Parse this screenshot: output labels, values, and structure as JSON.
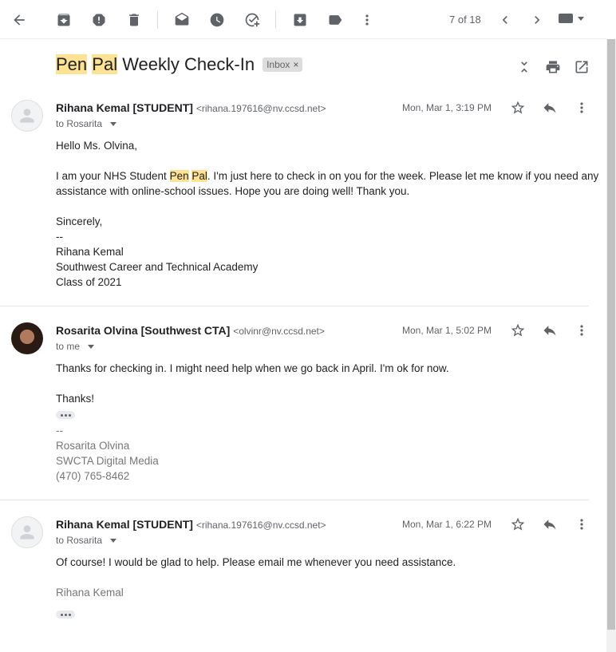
{
  "toolbar": {
    "pager": "7 of 18"
  },
  "subject": {
    "parts": [
      "Pen",
      " ",
      "Pal",
      " Weekly Check-In"
    ],
    "label": "Inbox",
    "label_close": "×"
  },
  "messages": [
    {
      "sender_name": "Rihana Kemal [STUDENT]",
      "sender_email": "<rihana.197616@nv.ccsd.net>",
      "to": "to Rosarita",
      "date": "Mon, Mar 1, 3:19 PM",
      "greeting": "Hello Ms. Olvina,",
      "body_line1_a": "I am your NHS Student ",
      "body_line1_hl1": "Pen",
      "body_line1_sp": " ",
      "body_line1_hl2": "Pal",
      "body_line1_b": ". I'm just here to check in on you for the week. Please let me know if you need any",
      "body_line2": "assistance with online-school issues. Hope you are doing well! Thank you.",
      "sign_off": "Sincerely,",
      "sig_dash": "--",
      "sig_name": "Rihana Kemal",
      "sig_school": "Southwest Career and Technical Academy",
      "sig_class": "Class of 2021"
    },
    {
      "sender_name": "Rosarita Olvina [Southwest CTA]",
      "sender_email": "<olvinr@nv.ccsd.net>",
      "to": "to me",
      "date": "Mon, Mar 1, 5:02 PM",
      "body_line1": "Thanks for checking in. I might need help when we go back in April. I'm ok for now.",
      "body_line2": "Thanks!",
      "sig_dash": "--",
      "sig_name": "Rosarita Olvina",
      "sig_dept": "SWCTA Digital Media",
      "sig_phone": "(470) 765-8462"
    },
    {
      "sender_name": "Rihana Kemal [STUDENT]",
      "sender_email": "<rihana.197616@nv.ccsd.net>",
      "to": "to Rosarita",
      "date": "Mon, Mar 1, 6:22 PM",
      "body_line1": "Of course! I would be glad to help. Please email me whenever you need assistance.",
      "sig_name": "Rihana Kemal"
    }
  ],
  "icons": {
    "back": "arrow-back-icon",
    "archive": "archive-icon",
    "spam": "report-spam-icon",
    "delete": "delete-icon",
    "mark_read": "mark-as-read-icon",
    "snooze": "snooze-icon",
    "add_task": "add-task-icon",
    "move": "move-to-icon",
    "label": "label-icon",
    "more": "more-vert-icon",
    "prev": "chevron-left-icon",
    "next": "chevron-right-icon",
    "keyboard": "keyboard-icon",
    "collapse": "collapse-all-icon",
    "print": "print-icon",
    "open_new": "open-in-new-window-icon",
    "star": "star-icon",
    "reply": "reply-icon"
  },
  "colors": {
    "highlight": "#fde293",
    "icon": "#5f6368"
  }
}
